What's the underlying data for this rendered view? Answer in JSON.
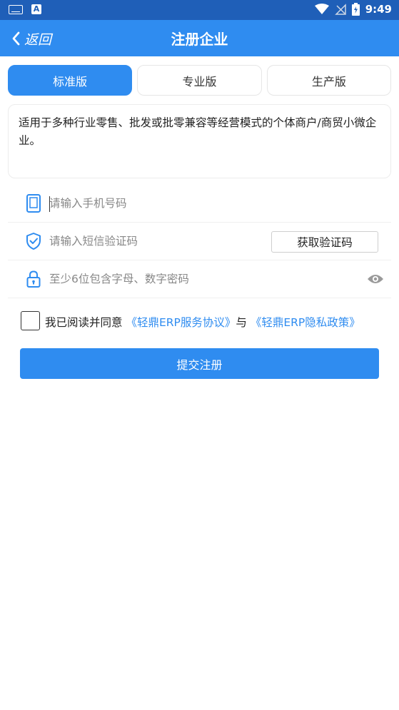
{
  "status_bar": {
    "time": "9:49",
    "badge": "A"
  },
  "nav": {
    "back_label": "返回",
    "title": "注册企业"
  },
  "tabs": [
    {
      "label": "标准版",
      "active": true
    },
    {
      "label": "专业版",
      "active": false
    },
    {
      "label": "生产版",
      "active": false
    }
  ],
  "description": "适用于多种行业零售、批发或批零兼容等经营模式的个体商户/商贸小微企业。",
  "form": {
    "phone_placeholder": "请输入手机号码",
    "sms_placeholder": "请输入短信验证码",
    "sms_button": "获取验证码",
    "password_placeholder": "至少6位包含字母、数字密码"
  },
  "agreement": {
    "prefix": "我已阅读并同意",
    "service_link": "《轻鼎ERP服务协议》",
    "conjunction": "与",
    "privacy_link": "《轻鼎ERP隐私政策》"
  },
  "submit_label": "提交注册",
  "colors": {
    "primary": "#2f8cf0",
    "status_bar": "#1f5fb8"
  }
}
